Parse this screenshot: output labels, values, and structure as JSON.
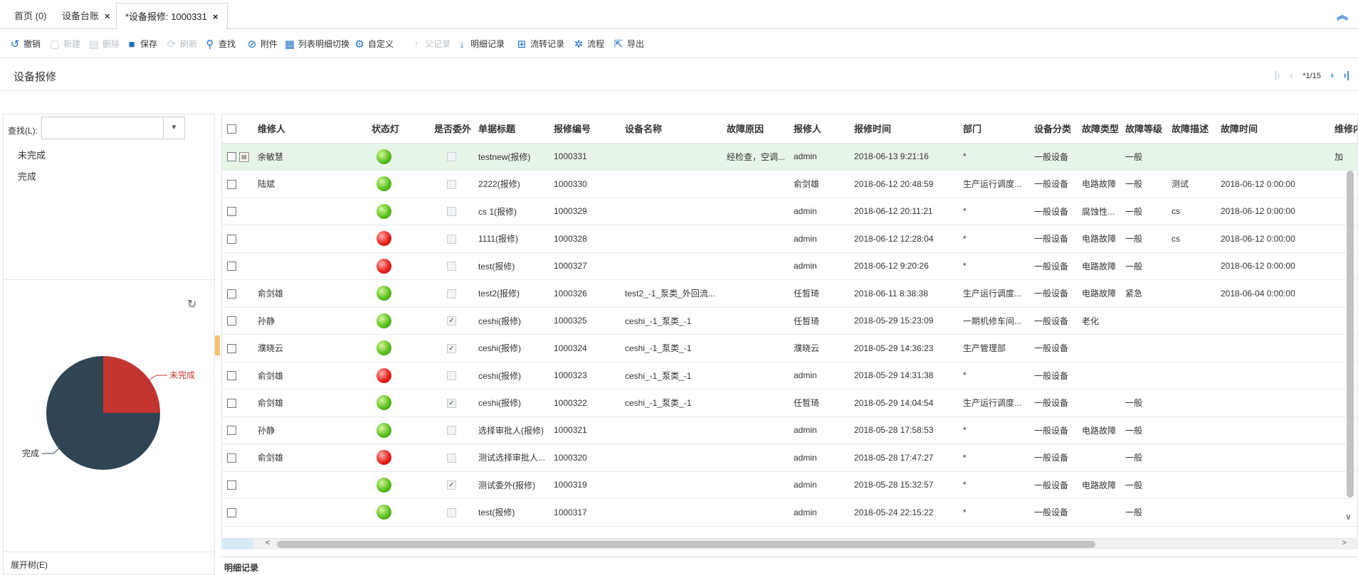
{
  "tabs": [
    {
      "label": "首页 (0)",
      "closable": false
    },
    {
      "label": "设备台账",
      "closable": true
    },
    {
      "label": "*设备报修: 1000331",
      "closable": true
    }
  ],
  "toolbar": {
    "undo": "撤销",
    "new": "新建",
    "delete": "删除",
    "save": "保存",
    "refresh": "刷新",
    "find": "查找",
    "attach": "附件",
    "switch": "列表明细切换",
    "custom": "自定义",
    "parent": "父记录",
    "detail": "明细记录",
    "flow_record": "流转记录",
    "flow": "流程",
    "export": "导出"
  },
  "page": {
    "title": "设备报修",
    "pager": "*1/15"
  },
  "left": {
    "search_label": "查找(L):",
    "search_value": "",
    "filters": [
      "未完成",
      "完成"
    ],
    "expand_tree": "展开树(E)",
    "chart_labels": {
      "incomplete": "未完成",
      "complete": "完成"
    }
  },
  "chart_data": {
    "type": "pie",
    "labels": [
      "未完成",
      "完成"
    ],
    "values": [
      25,
      75
    ],
    "colors": [
      "#c23531",
      "#2f4554"
    ]
  },
  "grid": {
    "headers": [
      "维修人",
      "状态灯",
      "是否委外",
      "单据标题",
      "报修编号",
      "设备名称",
      "故障原因",
      "报修人",
      "报修时间",
      "部门",
      "设备分类",
      "故障类型",
      "故障等级",
      "故障描述",
      "故障时间",
      "维修内"
    ],
    "rows": [
      {
        "repairer": "余敏慧",
        "light": "green",
        "outsource": false,
        "title": "testnew(报修)",
        "no": "1000331",
        "device": "",
        "reason": "经检查，空调...",
        "reporter": "admin",
        "time": "2018-06-13 9:21:16",
        "dept": "*",
        "category": "一般设备",
        "ftype": "",
        "level": "一般",
        "desc": "",
        "ftime": "",
        "content": "加",
        "selected": true
      },
      {
        "repairer": "陆斌",
        "light": "green",
        "outsource": false,
        "title": "2222(报修)",
        "no": "1000330",
        "device": "",
        "reason": "",
        "reporter": "俞剑雄",
        "time": "2018-06-12 20:48:59",
        "dept": "生产运行调度...",
        "category": "一般设备",
        "ftype": "电路故障",
        "level": "一般",
        "desc": "测试",
        "ftime": "2018-06-12 0:00:00",
        "content": ""
      },
      {
        "repairer": "",
        "light": "green",
        "outsource": false,
        "title": "cs 1(报修)",
        "no": "1000329",
        "device": "",
        "reason": "",
        "reporter": "admin",
        "time": "2018-06-12 20:11:21",
        "dept": "*",
        "category": "一般设备",
        "ftype": "腐蚀性...",
        "level": "一般",
        "desc": "cs",
        "ftime": "2018-06-12 0:00:00",
        "content": ""
      },
      {
        "repairer": "",
        "light": "red",
        "outsource": false,
        "title": "1111(报修)",
        "no": "1000328",
        "device": "",
        "reason": "",
        "reporter": "admin",
        "time": "2018-06-12 12:28:04",
        "dept": "*",
        "category": "一般设备",
        "ftype": "电路故障",
        "level": "一般",
        "desc": "cs",
        "ftime": "2018-06-12 0:00:00",
        "content": ""
      },
      {
        "repairer": "",
        "light": "red",
        "outsource": false,
        "title": "test(报修)",
        "no": "1000327",
        "device": "",
        "reason": "",
        "reporter": "admin",
        "time": "2018-06-12 9:20:26",
        "dept": "*",
        "category": "一般设备",
        "ftype": "电路故障",
        "level": "一般",
        "desc": "",
        "ftime": "2018-06-12 0:00:00",
        "content": ""
      },
      {
        "repairer": "俞剑雄",
        "light": "green",
        "outsource": false,
        "title": "test2(报修)",
        "no": "1000326",
        "device": "test2_-1_泵类_外回流...",
        "reason": "",
        "reporter": "任皙琦",
        "time": "2018-06-11 8:38:38",
        "dept": "生产运行调度...",
        "category": "一般设备",
        "ftype": "电路故障",
        "level": "紧急",
        "desc": "",
        "ftime": "2018-06-04 0:00:00",
        "content": ""
      },
      {
        "repairer": "孙静",
        "light": "green",
        "outsource": true,
        "title": "ceshi(报修)",
        "no": "1000325",
        "device": "ceshi_-1_泵类_-1",
        "reason": "",
        "reporter": "任皙琦",
        "time": "2018-05-29 15:23:09",
        "dept": "一期机修车间...",
        "category": "一般设备",
        "ftype": "老化",
        "level": "",
        "desc": "",
        "ftime": "",
        "content": ""
      },
      {
        "repairer": "濮晓云",
        "light": "green",
        "outsource": true,
        "title": "ceshi(报修)",
        "no": "1000324",
        "device": "ceshi_-1_泵类_-1",
        "reason": "",
        "reporter": "濮晓云",
        "time": "2018-05-29 14:36:23",
        "dept": "生产管理部",
        "category": "一般设备",
        "ftype": "",
        "level": "",
        "desc": "",
        "ftime": "",
        "content": ""
      },
      {
        "repairer": "俞剑雄",
        "light": "red",
        "outsource": false,
        "title": "ceshi(报修)",
        "no": "1000323",
        "device": "ceshi_-1_泵类_-1",
        "reason": "",
        "reporter": "admin",
        "time": "2018-05-29 14:31:38",
        "dept": "*",
        "category": "一般设备",
        "ftype": "",
        "level": "",
        "desc": "",
        "ftime": "",
        "content": ""
      },
      {
        "repairer": "俞剑雄",
        "light": "green",
        "outsource": true,
        "title": "ceshi(报修)",
        "no": "1000322",
        "device": "ceshi_-1_泵类_-1",
        "reason": "",
        "reporter": "任皙琦",
        "time": "2018-05-29 14:04:54",
        "dept": "生产运行调度...",
        "category": "一般设备",
        "ftype": "",
        "level": "一般",
        "desc": "",
        "ftime": "",
        "content": ""
      },
      {
        "repairer": "孙静",
        "light": "green",
        "outsource": false,
        "title": "选择审批人(报修)",
        "no": "1000321",
        "device": "",
        "reason": "",
        "reporter": "admin",
        "time": "2018-05-28 17:58:53",
        "dept": "*",
        "category": "一般设备",
        "ftype": "电路故障",
        "level": "一般",
        "desc": "",
        "ftime": "",
        "content": ""
      },
      {
        "repairer": "俞剑雄",
        "light": "red",
        "outsource": false,
        "title": "测试选择审批人...",
        "no": "1000320",
        "device": "",
        "reason": "",
        "reporter": "admin",
        "time": "2018-05-28 17:47:27",
        "dept": "*",
        "category": "一般设备",
        "ftype": "",
        "level": "一般",
        "desc": "",
        "ftime": "",
        "content": ""
      },
      {
        "repairer": "",
        "light": "green",
        "outsource": true,
        "title": "测试委外(报修)",
        "no": "1000319",
        "device": "",
        "reason": "",
        "reporter": "admin",
        "time": "2018-05-28 15:32:57",
        "dept": "*",
        "category": "一般设备",
        "ftype": "电路故障",
        "level": "一般",
        "desc": "",
        "ftime": "",
        "content": ""
      },
      {
        "repairer": "",
        "light": "green",
        "outsource": false,
        "title": "test(报修)",
        "no": "1000317",
        "device": "",
        "reason": "",
        "reporter": "admin",
        "time": "2018-05-24 22:15:22",
        "dept": "*",
        "category": "一般设备",
        "ftype": "",
        "level": "一般",
        "desc": "",
        "ftime": "",
        "content": ""
      }
    ]
  },
  "footer": {
    "label": "明细记录"
  }
}
